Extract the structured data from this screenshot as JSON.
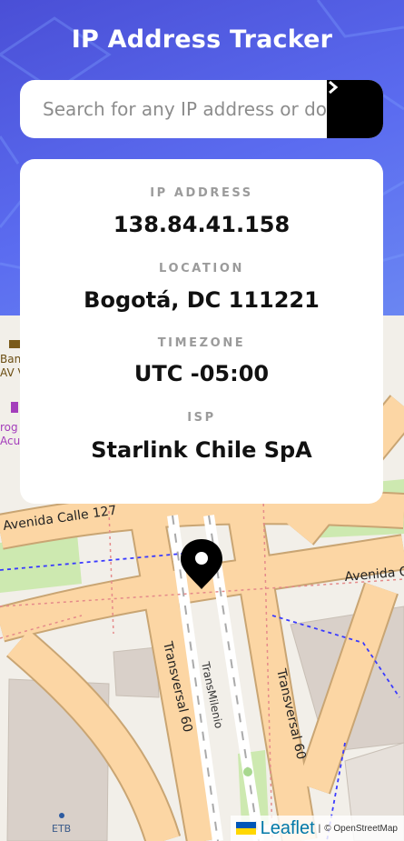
{
  "header": {
    "title": "IP Address Tracker",
    "accent": "#5b6cf0"
  },
  "search": {
    "placeholder": "Search for any IP address or domain",
    "value": "",
    "button_icon": "chevron-right-icon"
  },
  "info": {
    "ip_label": "IP ADDRESS",
    "ip_value": "138.84.41.158",
    "location_label": "LOCATION",
    "location_value": "Bogotá, DC 111221",
    "timezone_label": "TIMEZONE",
    "timezone_value": "UTC -05:00",
    "isp_label": "ISP",
    "isp_value": "Starlink Chile SpA"
  },
  "map": {
    "streets": {
      "avenida_calle_127": "Avenida Calle 127",
      "avenida_right": "Avenida C",
      "transversal_left": "Transversal 60",
      "transversal_right": "Transversal 60",
      "transmilenio": "TransMilenio"
    },
    "pois": {
      "bank_line1": "Ban",
      "bank_line2": "AV V",
      "drug_line1": "rog",
      "drug_line2": "Acu",
      "etb": "ETB"
    },
    "marker_icon": "map-pin-icon",
    "attribution": {
      "flag_icon": "ukraine-flag-icon",
      "leaflet": "Leaflet",
      "separator": "|",
      "osm": "© OpenStreetMap"
    }
  }
}
